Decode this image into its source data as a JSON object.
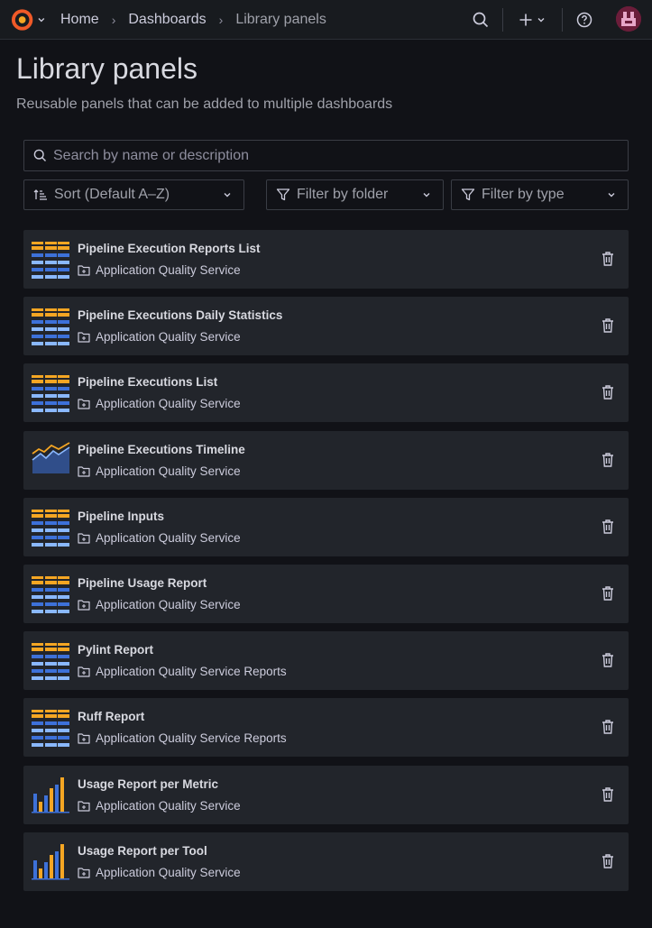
{
  "topbar": {
    "breadcrumbs": [
      {
        "label": "Home"
      },
      {
        "label": "Dashboards"
      },
      {
        "label": "Library panels"
      }
    ],
    "separator": "›",
    "icons": [
      "grafana-logo-icon",
      "search-icon",
      "plus-icon",
      "help-icon",
      "avatar"
    ]
  },
  "page": {
    "title": "Library panels",
    "subtitle": "Reusable panels that can be added to multiple dashboards"
  },
  "search": {
    "placeholder": "Search by name or description",
    "value": ""
  },
  "filters": {
    "sort_label": "Sort (Default A–Z)",
    "folder_label": "Filter by folder",
    "type_label": "Filter by type"
  },
  "panels": [
    {
      "title": "Pipeline Execution Reports List",
      "folder": "Application Quality Service",
      "viz": "table"
    },
    {
      "title": "Pipeline Executions Daily Statistics",
      "folder": "Application Quality Service",
      "viz": "table"
    },
    {
      "title": "Pipeline Executions List",
      "folder": "Application Quality Service",
      "viz": "table"
    },
    {
      "title": "Pipeline Executions Timeline",
      "folder": "Application Quality Service",
      "viz": "timeseries"
    },
    {
      "title": "Pipeline Inputs",
      "folder": "Application Quality Service",
      "viz": "table"
    },
    {
      "title": "Pipeline Usage Report",
      "folder": "Application Quality Service",
      "viz": "table"
    },
    {
      "title": "Pylint Report",
      "folder": "Application Quality Service Reports",
      "viz": "table"
    },
    {
      "title": "Ruff Report",
      "folder": "Application Quality Service Reports",
      "viz": "table"
    },
    {
      "title": "Usage Report per Metric",
      "folder": "Application Quality Service",
      "viz": "barchart"
    },
    {
      "title": "Usage Report per Tool",
      "folder": "Application Quality Service",
      "viz": "barchart"
    }
  ],
  "colors": {
    "background": "#111217",
    "row_background": "#22252b",
    "accent_orange": "#f5a623",
    "accent_blue": "#3d71d9"
  }
}
